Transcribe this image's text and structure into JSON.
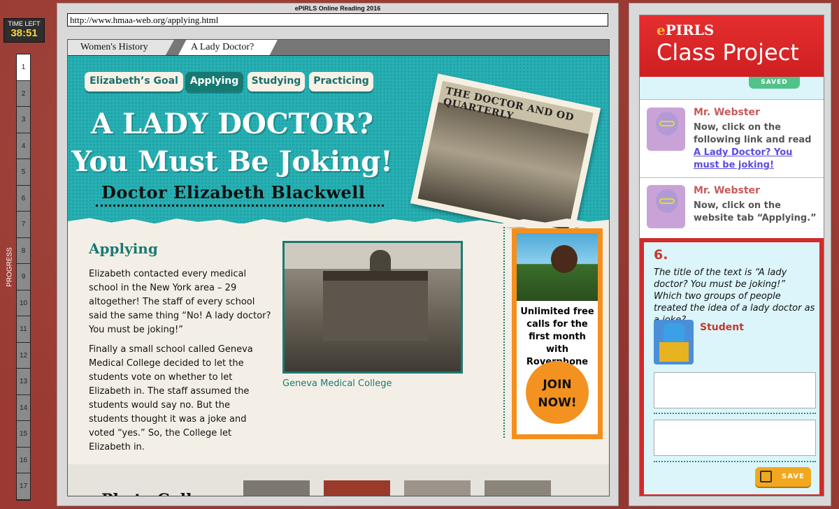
{
  "timer": {
    "label": "TIME LEFT",
    "value": "38:51"
  },
  "progress": {
    "label": "PROGRESS",
    "current": 1,
    "steps": [
      "1",
      "2",
      "3",
      "4",
      "5",
      "6",
      "7",
      "8",
      "9",
      "10",
      "11",
      "12",
      "13",
      "14",
      "15",
      "16",
      "17"
    ]
  },
  "center": {
    "title": "ePIRLS Online Reading 2016",
    "url": "http://www.hmaa-web.org/applying.html"
  },
  "browser_tabs": [
    "Women's History",
    "A Lady Doctor?"
  ],
  "site": {
    "nav": [
      "Elizabeth’s Goal",
      "Applying",
      "Studying",
      "Practicing"
    ],
    "active_nav": "Applying",
    "headline_1": "A LADY DOCTOR?",
    "headline_2": "You Must Be Joking!",
    "subtitle": "Doctor Elizabeth Blackwell",
    "magazine_title": "THE DOCTOR AND OD QUARTERLY",
    "article_heading": "Applying",
    "paragraph_1": "Elizabeth contacted every medical school in the New York area – 29 altogether! The staff of every school said the same thing “No! A lady doctor? You must be joking!”",
    "paragraph_2": "Finally a small school called Geneva Medical College decided to let the students vote on whether to let Elizabeth in. The staff assumed the students would say no. But the students thought it was a joke and voted “yes.” So, the College let Elizabeth in.",
    "photo_caption": "Geneva Medical College",
    "ad_text": "Unlimited free calls for the first month with Roverphone",
    "ad_button": "JOIN NOW!",
    "gallery_title": "Photo Gall"
  },
  "panel": {
    "logo_e": "e",
    "logo_rest": "PIRLS",
    "title": "Class Project",
    "saved_label": "SAVED",
    "messages": [
      {
        "name": "Mr. Webster",
        "text": "Now, click on the following link and read ",
        "link": "A Lady Doctor? You must be joking!"
      },
      {
        "name": "Mr. Webster",
        "text": "Now, click on the website tab “Applying.”"
      }
    ],
    "question_number": "6.",
    "question_text": "The title of the text is “A lady doctor? You must be joking!” Which two groups of people treated the idea of a lady doctor as a joke?",
    "student_name": "Student",
    "answer_1": "",
    "answer_2": "",
    "save_label": "SAVE"
  },
  "colors": {
    "accent_teal": "#26b0b3",
    "brand_red": "#d12b2b",
    "ad_orange": "#f48f1e"
  }
}
